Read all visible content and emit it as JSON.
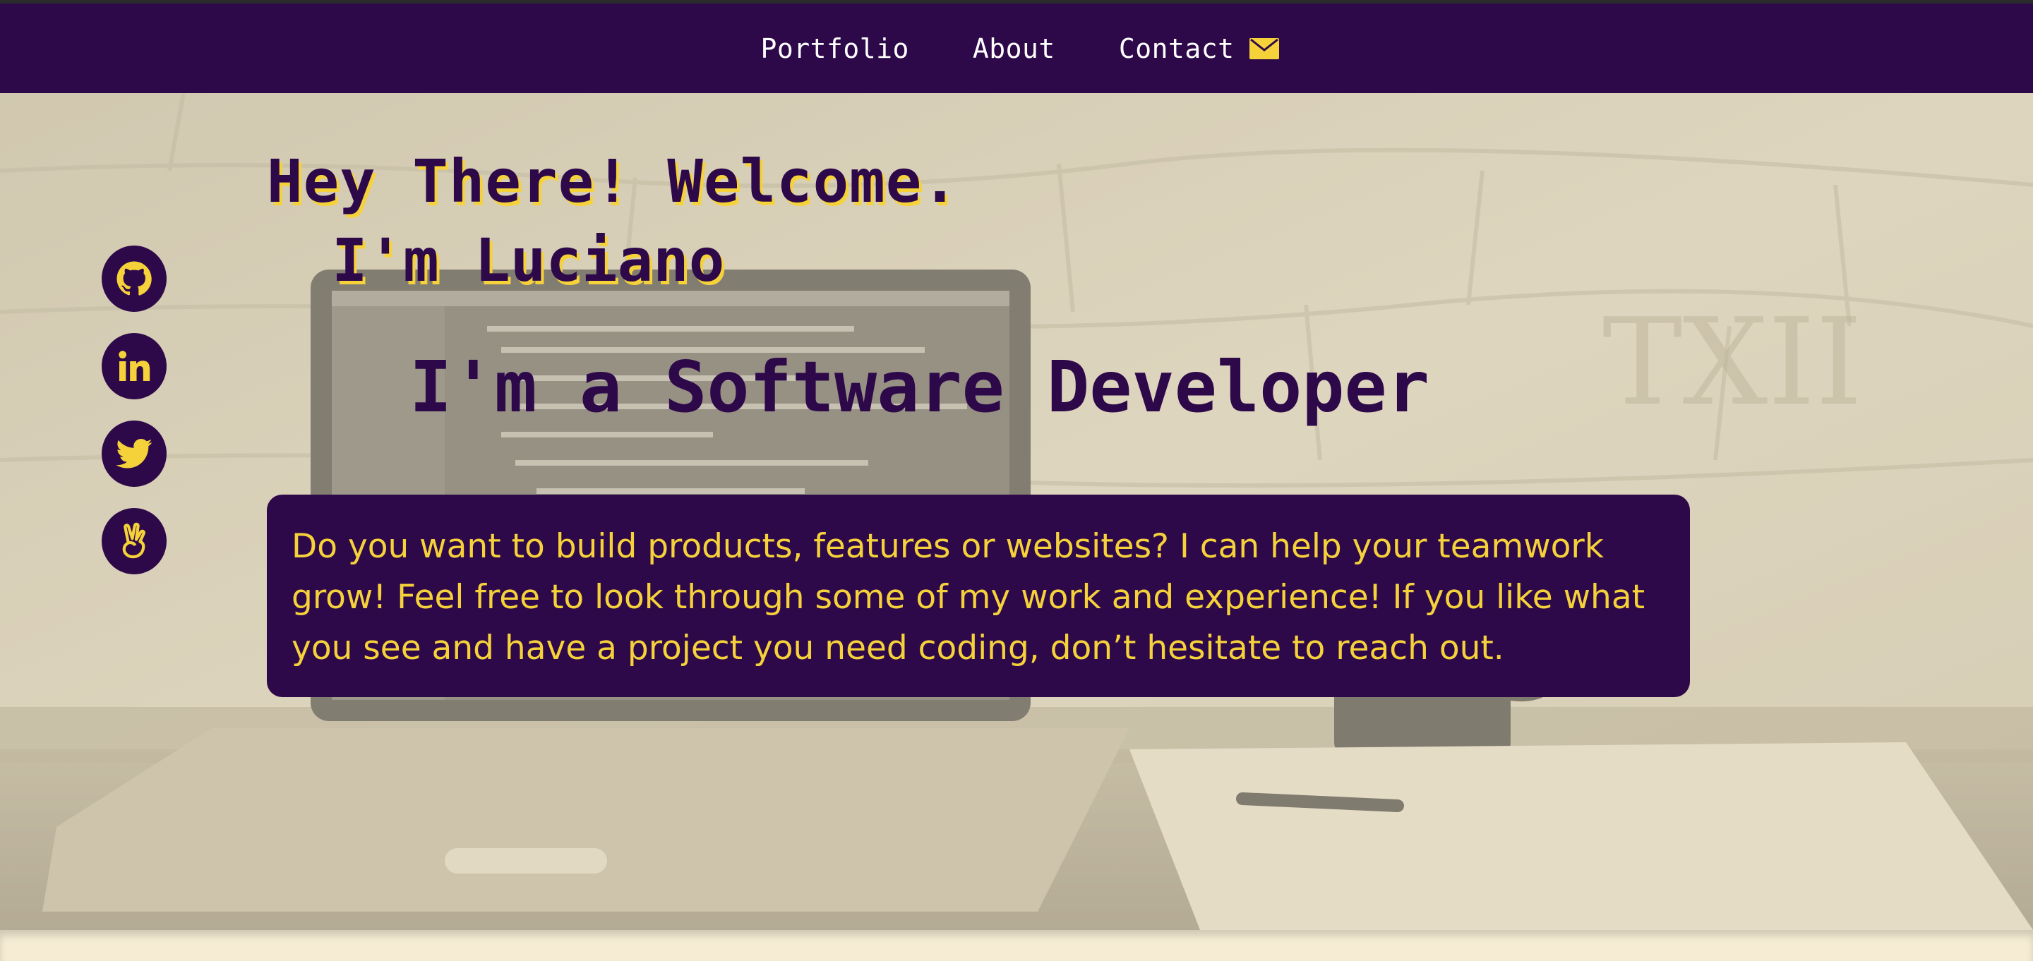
{
  "nav": {
    "items": [
      {
        "label": "Portfolio"
      },
      {
        "label": "About"
      },
      {
        "label": "Contact"
      }
    ],
    "contact_icon": "envelope-icon"
  },
  "hero": {
    "greeting": "Hey There! Welcome.",
    "name": "I'm Luciano",
    "role": "I'm a Software Developer",
    "intro": "Do you want to build products, features or websites? I can help your teamwork grow! Feel free to look through some of my work and experience! If you like what you see and have a project you need coding, don’t hesitate to reach out."
  },
  "socials": [
    {
      "icon": "github-icon"
    },
    {
      "icon": "linkedin-icon"
    },
    {
      "icon": "twitter-icon"
    },
    {
      "icon": "angellist-icon"
    }
  ],
  "colors": {
    "primary": "#2e094a",
    "accent": "#f6d23a",
    "background": "#f3ead4"
  }
}
